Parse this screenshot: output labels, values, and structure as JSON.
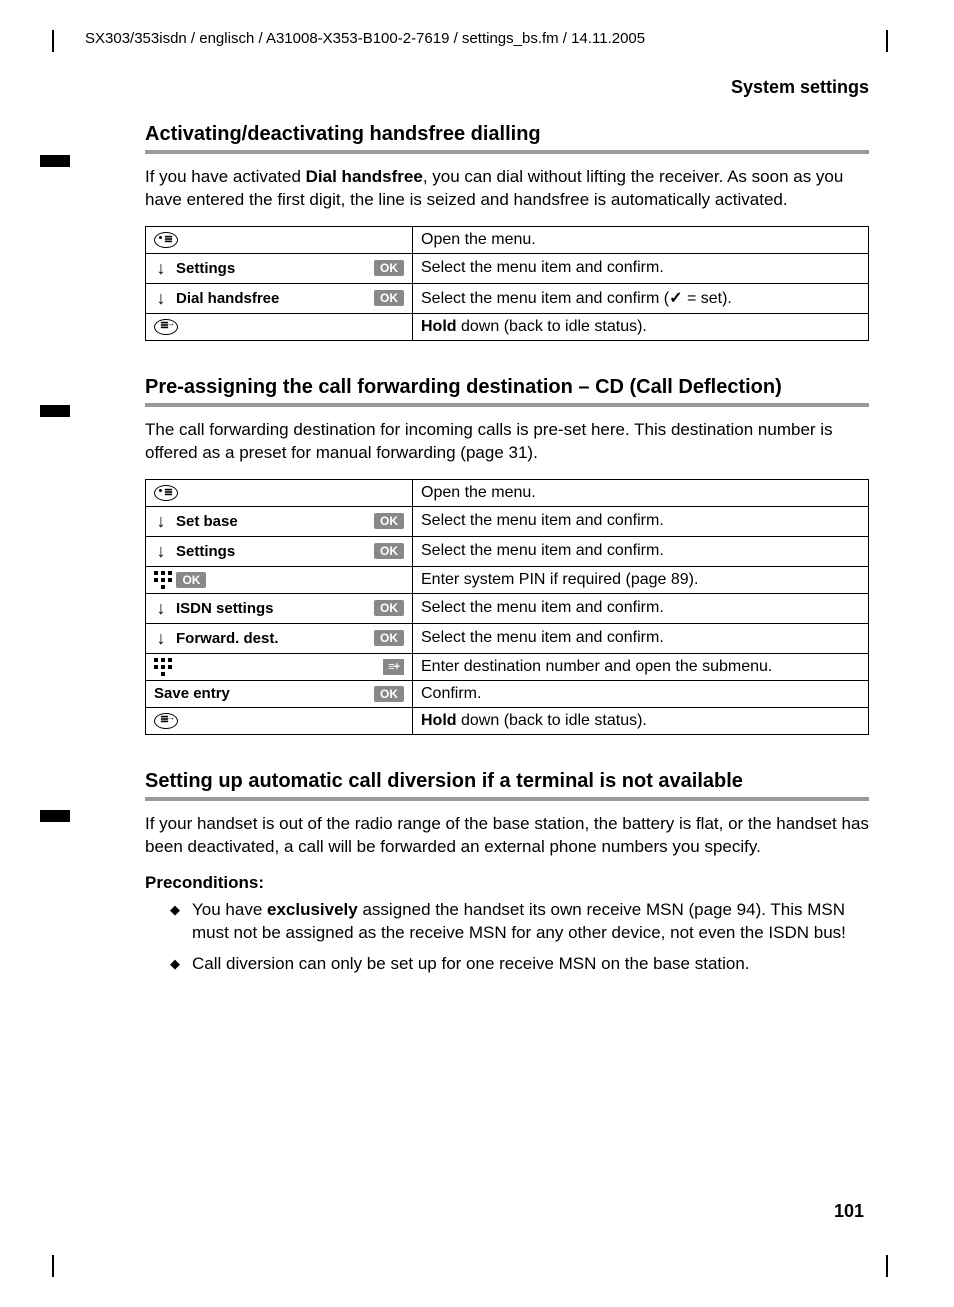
{
  "header_path": "SX303/353isdn / englisch / A31008-X353-B100-2-7619 / settings_bs.fm / 14.11.2005",
  "section_label": "System settings",
  "page_number": "101",
  "s1": {
    "heading": "Activating/deactivating handsfree dialling",
    "intro_pre": "If you have activated ",
    "intro_bold": "Dial handsfree",
    "intro_post": ", you can dial without lifting the receiver. As soon as you have entered the first digit, the line is seized and handsfree is automatically activated.",
    "rows": [
      {
        "type": "oval",
        "desc_pre": "",
        "desc_bold": "",
        "desc_post": "Open the menu."
      },
      {
        "type": "menuok",
        "label": "Settings",
        "desc_pre": "",
        "desc_bold": "",
        "desc_post": "Select the menu item and confirm."
      },
      {
        "type": "menuok",
        "label": "Dial handsfree",
        "desc_pre": "Select the menu item and confirm (",
        "desc_check": "✓",
        "desc_post": " = set)."
      },
      {
        "type": "ovalalt",
        "desc_hold": "Hold",
        "desc_post": " down (back to idle status)."
      }
    ]
  },
  "s2": {
    "heading": "Pre-assigning the call forwarding destination – CD (Call Deflection)",
    "intro": "The call forwarding destination for incoming calls is pre-set here. This destination number is offered as a preset for manual forwarding (page 31).",
    "rows": [
      {
        "type": "oval",
        "desc": "Open the menu."
      },
      {
        "type": "menuok",
        "label": "Set base",
        "desc": "Select the menu item and confirm."
      },
      {
        "type": "menuok",
        "label": "Settings",
        "desc": "Select the menu item and confirm."
      },
      {
        "type": "keypadok",
        "desc": "Enter system PIN if required (page 89)."
      },
      {
        "type": "menuok",
        "label": "ISDN settings",
        "desc": "Select the menu item and confirm."
      },
      {
        "type": "menuok",
        "label": "Forward. dest.",
        "desc": "Select the menu item and confirm."
      },
      {
        "type": "keypadsub",
        "desc": "Enter destination number and open the submenu."
      },
      {
        "type": "saveok",
        "label": "Save entry",
        "desc": "Confirm."
      },
      {
        "type": "ovalalt",
        "desc_hold": "Hold",
        "desc_post": " down (back to idle status)."
      }
    ]
  },
  "s3": {
    "heading": "Setting up automatic call diversion if a terminal is not available",
    "intro": "If your handset is out of the radio range of the base station, the battery is flat, or the handset has been deactivated, a call will be forwarded an external phone numbers you specify.",
    "pre_label": "Preconditions:",
    "bullets": [
      {
        "pre": "You have ",
        "bold": "exclusively",
        "post": " assigned the handset its own receive MSN (page 94). This MSN must not be assigned as the receive MSN for any other device, not even the ISDN bus!"
      },
      {
        "text": "Call diversion can only be set up for one receive MSN on the base station."
      }
    ]
  },
  "ok_label": "OK",
  "submenu_label": "≡+"
}
